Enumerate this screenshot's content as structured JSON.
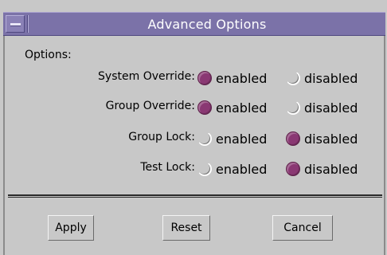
{
  "window": {
    "title": "Advanced Options"
  },
  "section_label": "Options:",
  "options": [
    {
      "label": "System Override:",
      "enabled_label": "enabled",
      "disabled_label": "disabled",
      "selected": "enabled"
    },
    {
      "label": "Group Override:",
      "enabled_label": "enabled",
      "disabled_label": "disabled",
      "selected": "enabled"
    },
    {
      "label": "Group Lock:",
      "enabled_label": "enabled",
      "disabled_label": "disabled",
      "selected": "disabled"
    },
    {
      "label": "Test Lock:",
      "enabled_label": "enabled",
      "disabled_label": "disabled",
      "selected": "disabled"
    }
  ],
  "buttons": {
    "apply": "Apply",
    "reset": "Reset",
    "cancel": "Cancel"
  },
  "colors": {
    "titlebar": "#7b72a8",
    "radio_selected": "#8a3873",
    "background": "#c8c8c8"
  },
  "icons": {
    "window_menu": "window-menu-icon"
  }
}
